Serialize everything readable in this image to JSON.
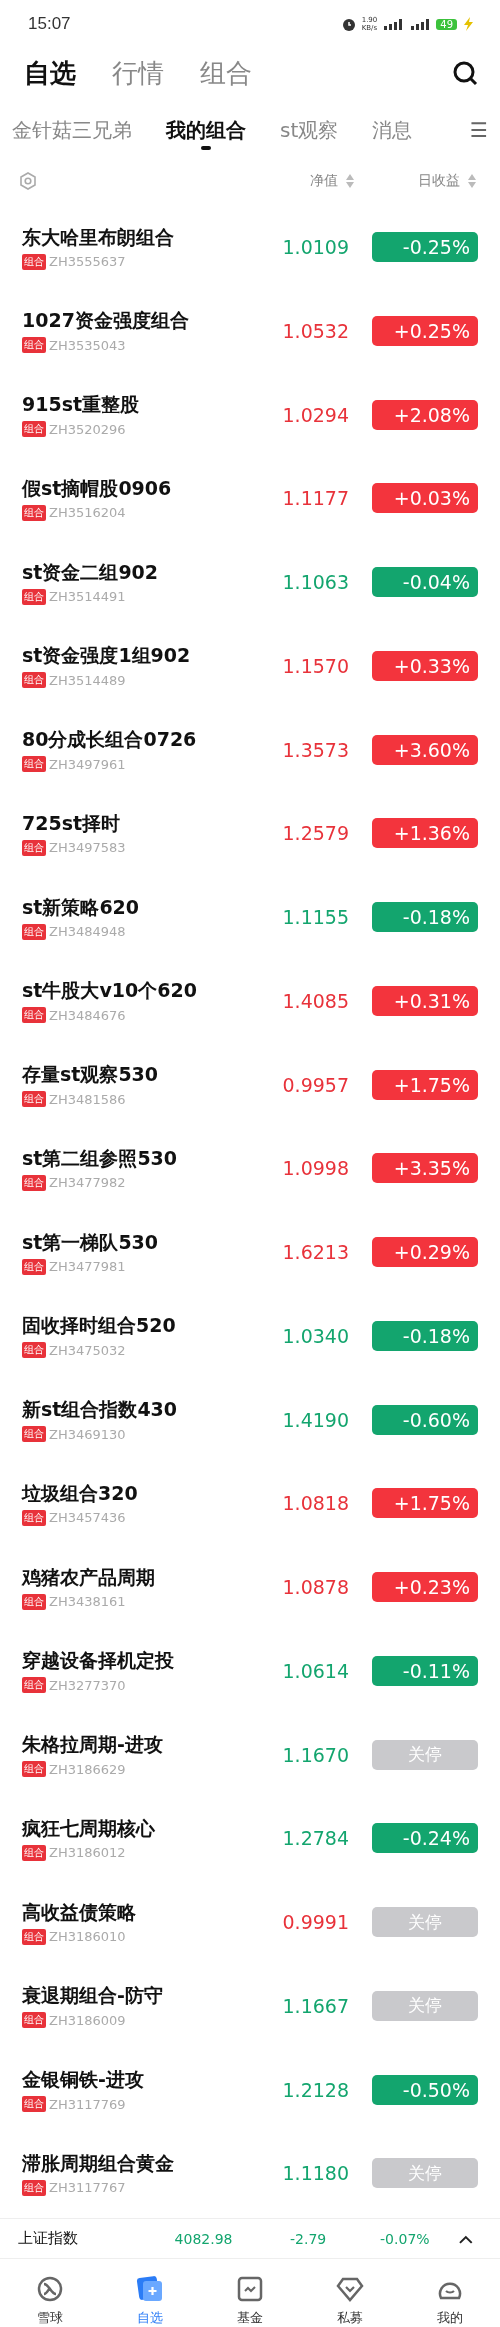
{
  "status_bar": {
    "time": "15:07",
    "speed": "1.90",
    "speed_unit": "KB/s",
    "battery": "49"
  },
  "main_tabs": [
    {
      "label": "自选",
      "selected": true
    },
    {
      "label": "行情",
      "selected": false
    },
    {
      "label": "组合",
      "selected": false
    }
  ],
  "sub_tabs": [
    {
      "label": "金针菇三兄弟",
      "selected": false
    },
    {
      "label": "我的组合",
      "selected": true
    },
    {
      "label": "st观察",
      "selected": false
    },
    {
      "label": "消息",
      "selected": false
    }
  ],
  "menu_glyph": "☰",
  "columns": {
    "nav": "净值",
    "daily": "日收益"
  },
  "rows": [
    {
      "name": "东大哈里布朗组合",
      "tag": "组合",
      "code": "ZH3555637",
      "nav": "1.0109",
      "color": "#13a56e",
      "change": "-0.25%",
      "kind": "down"
    },
    {
      "name": "1027资金强度组合",
      "tag": "组合",
      "code": "ZH3535043",
      "nav": "1.0532",
      "color": "#e8323a",
      "change": "+0.25%",
      "kind": "up"
    },
    {
      "name": "915st重整股",
      "tag": "组合",
      "code": "ZH3520296",
      "nav": "1.0294",
      "color": "#e8323a",
      "change": "+2.08%",
      "kind": "up"
    },
    {
      "name": "假st摘帽股0906",
      "tag": "组合",
      "code": "ZH3516204",
      "nav": "1.1177",
      "color": "#e8323a",
      "change": "+0.03%",
      "kind": "up"
    },
    {
      "name": "st资金二组902",
      "tag": "组合",
      "code": "ZH3514491",
      "nav": "1.1063",
      "color": "#13a56e",
      "change": "-0.04%",
      "kind": "down"
    },
    {
      "name": "st资金强度1组902",
      "tag": "组合",
      "code": "ZH3514489",
      "nav": "1.1570",
      "color": "#e8323a",
      "change": "+0.33%",
      "kind": "up"
    },
    {
      "name": "80分成长组合0726",
      "tag": "组合",
      "code": "ZH3497961",
      "nav": "1.3573",
      "color": "#e8323a",
      "change": "+3.60%",
      "kind": "up"
    },
    {
      "name": "725st择时",
      "tag": "组合",
      "code": "ZH3497583",
      "nav": "1.2579",
      "color": "#e8323a",
      "change": "+1.36%",
      "kind": "up"
    },
    {
      "name": "st新策略620",
      "tag": "组合",
      "code": "ZH3484948",
      "nav": "1.1155",
      "color": "#13a56e",
      "change": "-0.18%",
      "kind": "down"
    },
    {
      "name": "st牛股大v10个620",
      "tag": "组合",
      "code": "ZH3484676",
      "nav": "1.4085",
      "color": "#e8323a",
      "change": "+0.31%",
      "kind": "up"
    },
    {
      "name": "存量st观察530",
      "tag": "组合",
      "code": "ZH3481586",
      "nav": "0.9957",
      "color": "#e8323a",
      "change": "+1.75%",
      "kind": "up"
    },
    {
      "name": "st第二组参照530",
      "tag": "组合",
      "code": "ZH3477982",
      "nav": "1.0998",
      "color": "#e8323a",
      "change": "+3.35%",
      "kind": "up"
    },
    {
      "name": "st第一梯队530",
      "tag": "组合",
      "code": "ZH3477981",
      "nav": "1.6213",
      "color": "#e8323a",
      "change": "+0.29%",
      "kind": "up"
    },
    {
      "name": "固收择时组合520",
      "tag": "组合",
      "code": "ZH3475032",
      "nav": "1.0340",
      "color": "#13a56e",
      "change": "-0.18%",
      "kind": "down"
    },
    {
      "name": "新st组合指数430",
      "tag": "组合",
      "code": "ZH3469130",
      "nav": "1.4190",
      "color": "#13a56e",
      "change": "-0.60%",
      "kind": "down"
    },
    {
      "name": "垃圾组合320",
      "tag": "组合",
      "code": "ZH3457436",
      "nav": "1.0818",
      "color": "#e8323a",
      "change": "+1.75%",
      "kind": "up"
    },
    {
      "name": "鸡猪农产品周期",
      "tag": "组合",
      "code": "ZH3438161",
      "nav": "1.0878",
      "color": "#e8323a",
      "change": "+0.23%",
      "kind": "up"
    },
    {
      "name": "穿越设备择机定投",
      "tag": "组合",
      "code": "ZH3277370",
      "nav": "1.0614",
      "color": "#13a56e",
      "change": "-0.11%",
      "kind": "down"
    },
    {
      "name": "朱格拉周期-进攻",
      "tag": "组合",
      "code": "ZH3186629",
      "nav": "1.1670",
      "color": "#13a56e",
      "change": "关停",
      "kind": "halted"
    },
    {
      "name": "疯狂七周期核心",
      "tag": "组合",
      "code": "ZH3186012",
      "nav": "1.2784",
      "color": "#13a56e",
      "change": "-0.24%",
      "kind": "down"
    },
    {
      "name": "高收益债策略",
      "tag": "组合",
      "code": "ZH3186010",
      "nav": "0.9991",
      "color": "#e8323a",
      "change": "关停",
      "kind": "halted"
    },
    {
      "name": "衰退期组合-防守",
      "tag": "组合",
      "code": "ZH3186009",
      "nav": "1.1667",
      "color": "#13a56e",
      "change": "关停",
      "kind": "halted"
    },
    {
      "name": "金银铜铁-进攻",
      "tag": "组合",
      "code": "ZH3117769",
      "nav": "1.2128",
      "color": "#13a56e",
      "change": "-0.50%",
      "kind": "down"
    },
    {
      "name": "滞胀周期组合黄金",
      "tag": "组合",
      "code": "ZH3117767",
      "nav": "1.1180",
      "color": "#13a56e",
      "change": "关停",
      "kind": "halted"
    }
  ],
  "index_bar": {
    "name": "上证指数",
    "value": "4082.98",
    "change": "-2.79",
    "percent": "-0.07%"
  },
  "bottom_nav": [
    {
      "label": "雪球",
      "selected": false
    },
    {
      "label": "自选",
      "selected": true
    },
    {
      "label": "基金",
      "selected": false
    },
    {
      "label": "私募",
      "selected": false
    },
    {
      "label": "我的",
      "selected": false
    }
  ]
}
